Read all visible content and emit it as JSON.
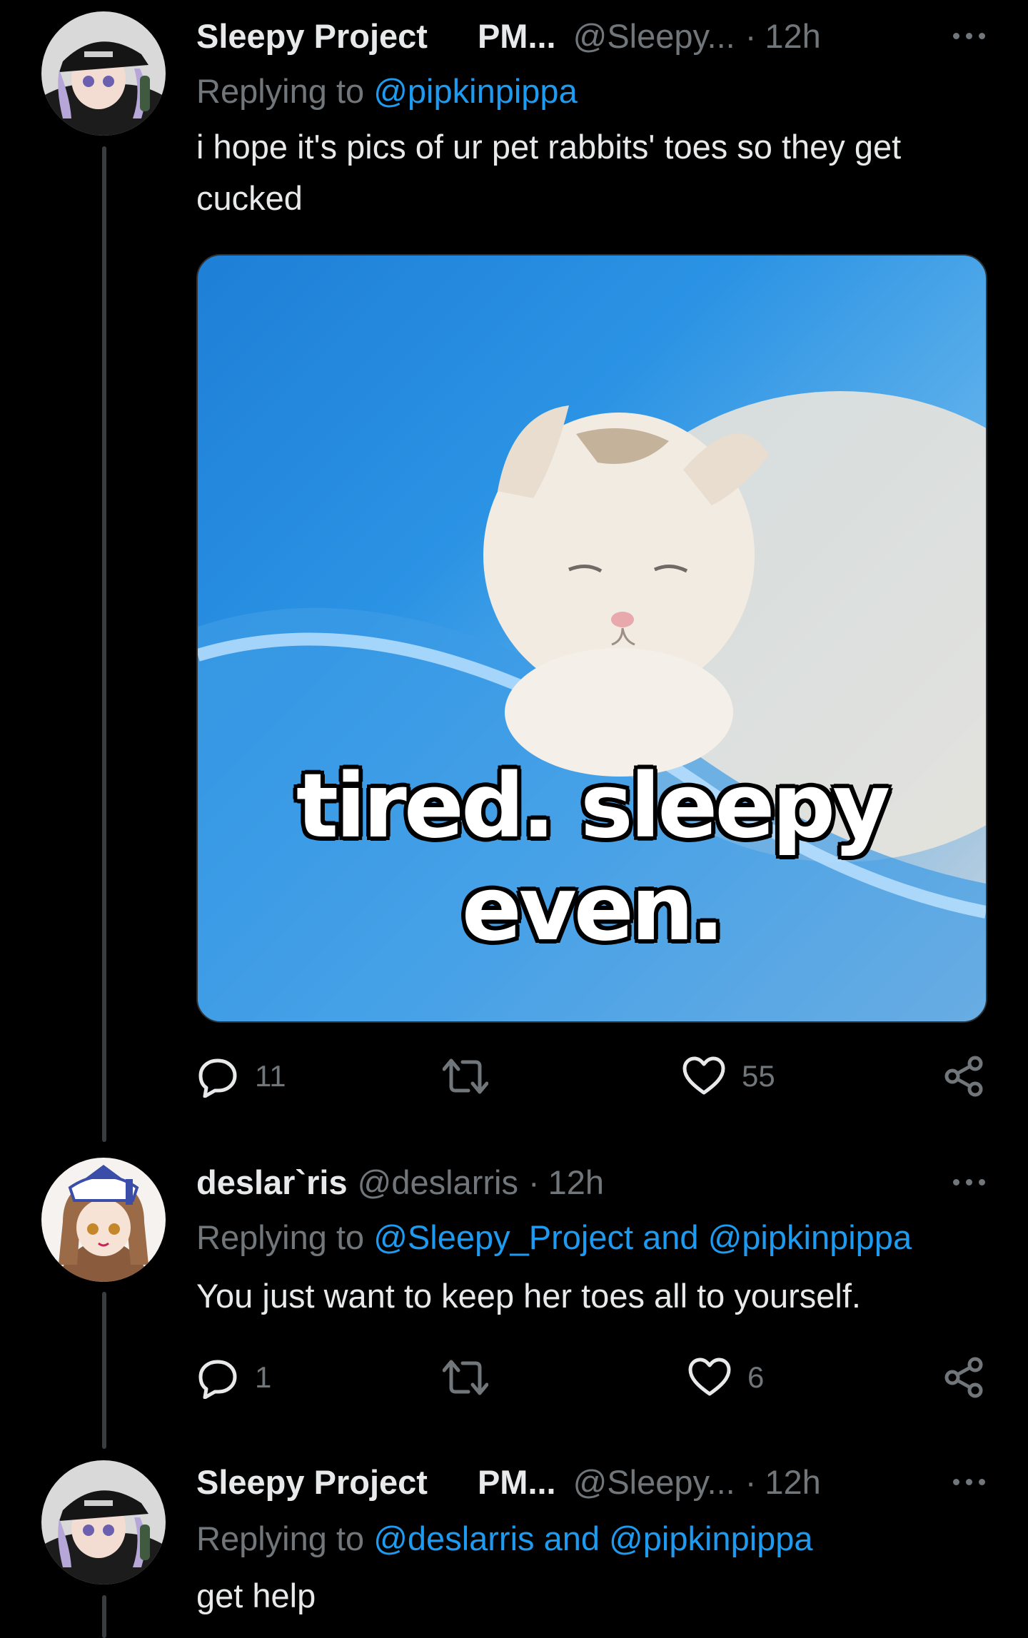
{
  "tweets": [
    {
      "display_name": "Sleepy Project",
      "org": "PM...",
      "handle": "@Sleepy...",
      "dot": "·",
      "time": "12h",
      "reply_prefix": "Replying to ",
      "reply_mentions": "@pipkinpippa",
      "text": "i hope it's pics of ur pet rabbits' toes so they get cucked",
      "media_caption": "tired. sleepy even.",
      "replies": "11",
      "retweets": "",
      "likes": "55"
    },
    {
      "display_name": "deslar`ris",
      "handle": "@deslarris",
      "dot": "·",
      "time": "12h",
      "reply_prefix": "Replying to ",
      "reply_mentions": "@Sleepy_Project and @pipkinpippa",
      "text": "You just want to keep her toes all to yourself.",
      "replies": "1",
      "retweets": "",
      "likes": "6"
    },
    {
      "display_name": "Sleepy Project",
      "org": "PM...",
      "handle": "@Sleepy...",
      "dot": "·",
      "time": "12h",
      "reply_prefix": "Replying to ",
      "reply_mentions": "@deslarris and @pipkinpippa",
      "text": "get help"
    }
  ],
  "icons": {
    "reply": "reply-icon",
    "retweet": "retweet-icon",
    "like": "heart-icon",
    "share": "share-icon",
    "more": "more-icon",
    "moon": "crescent-moon-icon"
  },
  "colors": {
    "background": "#000000",
    "text": "#e7e9ea",
    "secondary": "#71767b",
    "link": "#1d9bf0",
    "moon": "#f7b928"
  }
}
